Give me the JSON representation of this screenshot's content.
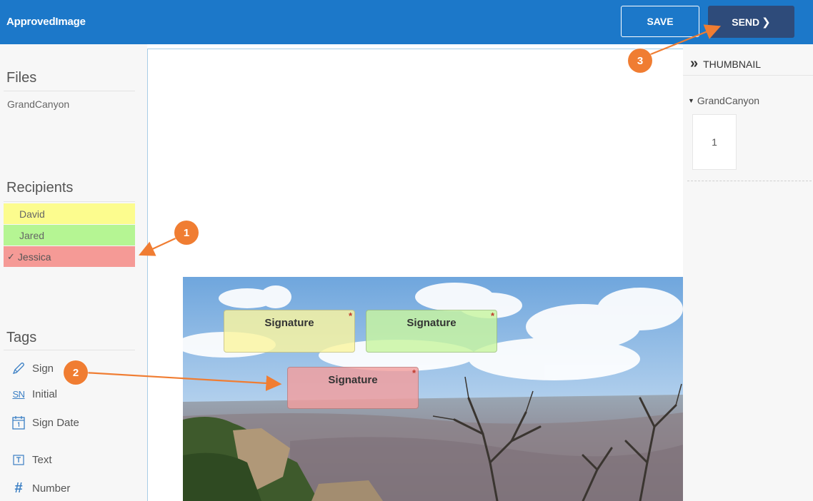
{
  "header": {
    "app_title": "ApprovedImage",
    "save_label": "SAVE",
    "send_label": "SEND",
    "send_chevron": "❯",
    "bg_color": "#1c78c9"
  },
  "files": {
    "title": "Files",
    "items": [
      "GrandCanyon"
    ]
  },
  "recipients": {
    "title": "Recipients",
    "items": [
      {
        "name": "David",
        "color": "#fcfc8e",
        "selected": false
      },
      {
        "name": "Jared",
        "color": "#b5f593",
        "selected": false
      },
      {
        "name": "Jessica",
        "color": "#f59a96",
        "selected": true
      }
    ],
    "check_glyph": "✓"
  },
  "tags": {
    "title": "Tags",
    "items": [
      {
        "label": "Sign",
        "icon": "pen-icon"
      },
      {
        "label": "Initial",
        "icon": "initial-icon",
        "icon_text": "SN"
      },
      {
        "label": "Sign Date",
        "icon": "calendar-icon"
      },
      {
        "label": "Text",
        "icon": "text-field-icon"
      },
      {
        "label": "Number",
        "icon": "hash-icon",
        "icon_text": "#"
      }
    ]
  },
  "document": {
    "fields": [
      {
        "label": "Signature",
        "required_mark": "*",
        "recipient": "David"
      },
      {
        "label": "Signature",
        "required_mark": "*",
        "recipient": "Jared"
      },
      {
        "label": "Signature",
        "required_mark": "*",
        "recipient": "Jessica"
      }
    ]
  },
  "thumbnail": {
    "header_icon": "»",
    "title": "THUMBNAIL",
    "file_label": "GrandCanyon",
    "caret": "▼",
    "pages": [
      "1"
    ]
  },
  "annotations": {
    "badges": [
      "1",
      "2",
      "3"
    ],
    "accent_color": "#f07d32"
  }
}
